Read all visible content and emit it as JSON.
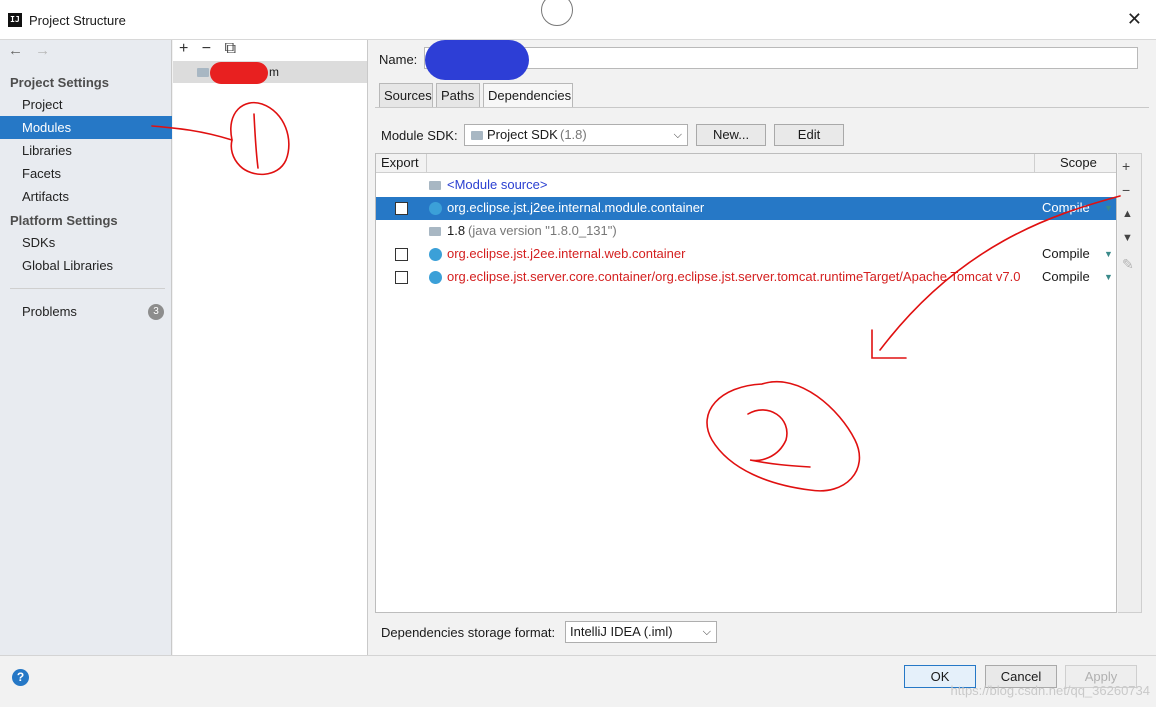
{
  "window": {
    "title": "Project Structure",
    "close_symbol": "✕",
    "app_icon_text": "IJ"
  },
  "sidebar": {
    "back_symbol": "←",
    "forward_symbol": "→",
    "project_settings_header": "Project Settings",
    "project_settings_items": [
      "Project",
      "Modules",
      "Libraries",
      "Facets",
      "Artifacts"
    ],
    "selected_item": "Modules",
    "platform_settings_header": "Platform Settings",
    "platform_settings_items": [
      "SDKs",
      "Global Libraries"
    ],
    "problems_label": "Problems",
    "problems_count": "3"
  },
  "module_list": {
    "add_symbol": "+",
    "remove_symbol": "−",
    "copy_symbol": "⧉",
    "module_name_suffix": "m"
  },
  "content": {
    "name_label": "Name:",
    "tabs": [
      "Sources",
      "Paths",
      "Dependencies"
    ],
    "active_tab": "Dependencies",
    "module_sdk_label": "Module SDK:",
    "sdk_value": "Project SDK",
    "sdk_version": "(1.8)",
    "new_button": "New...",
    "edit_button": "Edit",
    "table_headers": {
      "export": "Export",
      "scope": "Scope"
    },
    "dependencies": [
      {
        "text": "<Module source>",
        "extra": "",
        "scope": "",
        "checkbox": false,
        "icon": "folder-icon",
        "color": "#2a3fd1",
        "selected": false
      },
      {
        "text": "org.eclipse.jst.j2ee.internal.module.container",
        "extra": "",
        "scope": "Compile",
        "checkbox": true,
        "icon": "library-icon",
        "color": "#ffffff",
        "selected": true
      },
      {
        "text": "1.8",
        "extra": "(java version \"1.8.0_131\")",
        "scope": "",
        "checkbox": false,
        "icon": "folder-icon",
        "color": "#1a1a1a",
        "selected": false
      },
      {
        "text": "org.eclipse.jst.j2ee.internal.web.container",
        "extra": "",
        "scope": "Compile",
        "checkbox": true,
        "icon": "library-icon",
        "color": "#d42020",
        "selected": false
      },
      {
        "text": "org.eclipse.jst.server.core.container/org.eclipse.jst.server.tomcat.runtimeTarget/Apache Tomcat v7.0",
        "extra": "",
        "scope": "Compile",
        "checkbox": true,
        "icon": "library-icon",
        "color": "#d42020",
        "selected": false
      }
    ],
    "side_tools": {
      "add": "+",
      "remove": "−",
      "up": "▲",
      "down": "▼",
      "edit": "✎"
    },
    "storage_format_label": "Dependencies storage format:",
    "storage_format_value": "IntelliJ IDEA (.iml)"
  },
  "footer": {
    "help_symbol": "?",
    "ok_button": "OK",
    "cancel_button": "Cancel",
    "apply_button": "Apply",
    "watermark": "https://blog.csdn.net/qq_36260734"
  },
  "annotations": {
    "circle_1_label": "1",
    "circle_2_label": "2",
    "ink_color": "#e01010"
  },
  "colors": {
    "selection_blue": "#2678c6",
    "redaction_red": "#e82020",
    "redaction_blue": "#2d3ed6"
  }
}
